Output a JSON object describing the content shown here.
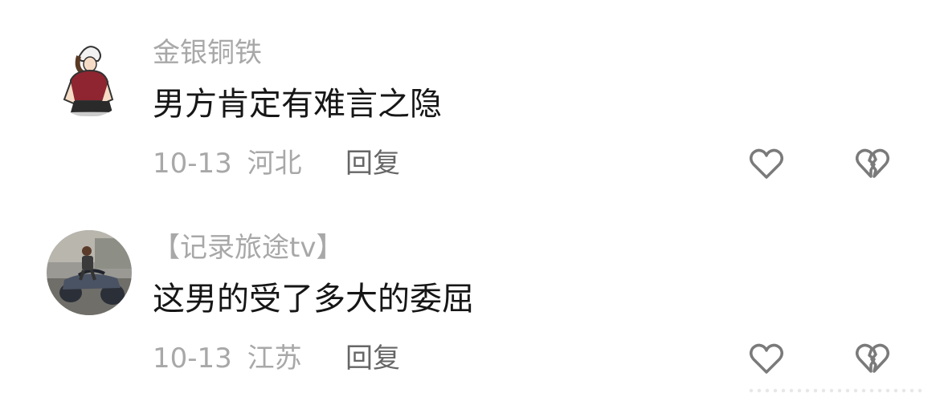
{
  "comments": [
    {
      "username": "金银铜铁",
      "content": "男方肯定有难言之隐",
      "date": "10-13",
      "location": "河北",
      "reply_label": "回复",
      "avatar_icon": "cartoon-person-avatar"
    },
    {
      "username": "【记录旅途tv】",
      "content": "这男的受了多大的委屈",
      "date": "10-13",
      "location": "江苏",
      "reply_label": "回复",
      "avatar_icon": "atv-rider-photo-avatar"
    }
  ],
  "icons": {
    "like": "heart-outline-icon",
    "dislike": "broken-heart-outline-icon"
  },
  "colors": {
    "username": "#a8a8a8",
    "content": "#161616",
    "meta": "#a8a8a8",
    "reply": "#666666",
    "icon": "#7a7a7a"
  }
}
